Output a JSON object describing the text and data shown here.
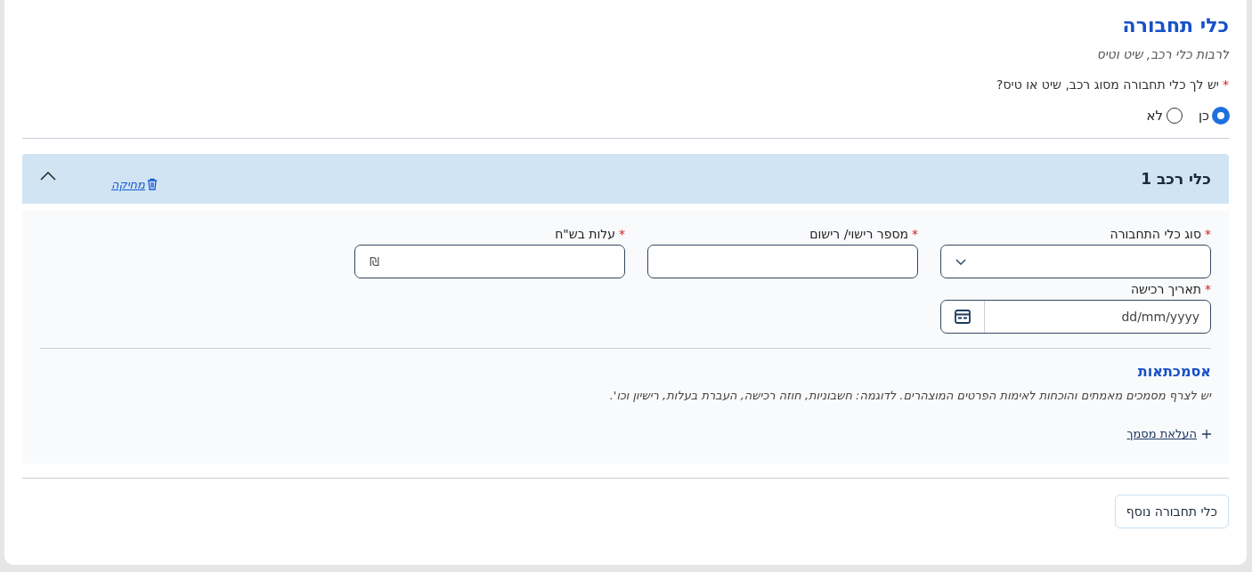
{
  "title": "כלי תחבורה",
  "subtitle": "לרבות כלי רכב, שיט וטיס",
  "question": {
    "label": "יש לך כלי תחבורה מסוג רכב, שיט או טיס?",
    "required": true
  },
  "radios": [
    {
      "label": "כן",
      "selected": true
    },
    {
      "label": "לא",
      "selected": false
    }
  ],
  "vehicle": {
    "title": "כלי רכב 1",
    "expanded": true,
    "delete_link": "מחיקה",
    "fields": [
      {
        "label": "סוג כלי התחבורה",
        "kind": "select",
        "required": true
      },
      {
        "label": "מספר רישוי/ רישום",
        "kind": "text",
        "required": true
      },
      {
        "label": "עלות בש\"ח",
        "kind": "currency",
        "required": true,
        "symbol": "₪"
      },
      {
        "label": "תאריך רכישה",
        "kind": "date",
        "required": true,
        "placeholder": "dd/mm/yyyy"
      }
    ],
    "documents": {
      "title": "אסמכתאות",
      "description": "יש לצרף מסמכים מאמתים והוכחות לאימות הפרטים המוצהרים. לדוגמה: חשבוניות, חוזה רכישה, העברת בעלות, רישיון וכו'.",
      "upload_link": "העלאת מסמך"
    }
  },
  "add_button": "כלי תחבורה נוסף",
  "required_mark": "*"
}
